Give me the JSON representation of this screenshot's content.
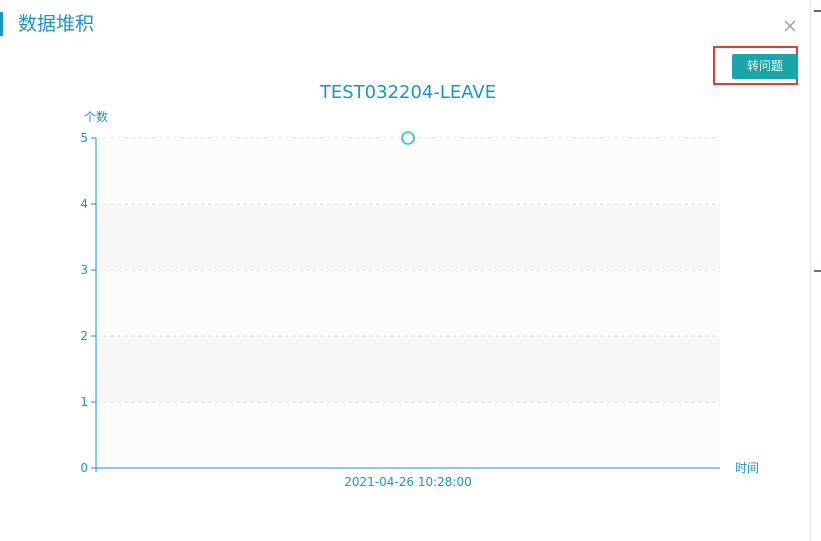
{
  "dialog": {
    "title": "数据堆积",
    "close_icon": "close-icon",
    "action_button_label": "转问题"
  },
  "colors": {
    "accent": "#1a95c4",
    "button": "#1aa6a8",
    "highlight": "#e23b3b",
    "point": "#23c6c8"
  },
  "chart_data": {
    "type": "scatter",
    "title": "TEST032204-LEAVE",
    "xlabel": "时间",
    "ylabel": "个数",
    "categories": [
      "2021-04-26 10:28:00"
    ],
    "values": [
      5
    ],
    "ylim": [
      0,
      5
    ],
    "yticks": [
      0,
      1,
      2,
      3,
      4,
      5
    ],
    "grid": true,
    "legend": "none"
  }
}
